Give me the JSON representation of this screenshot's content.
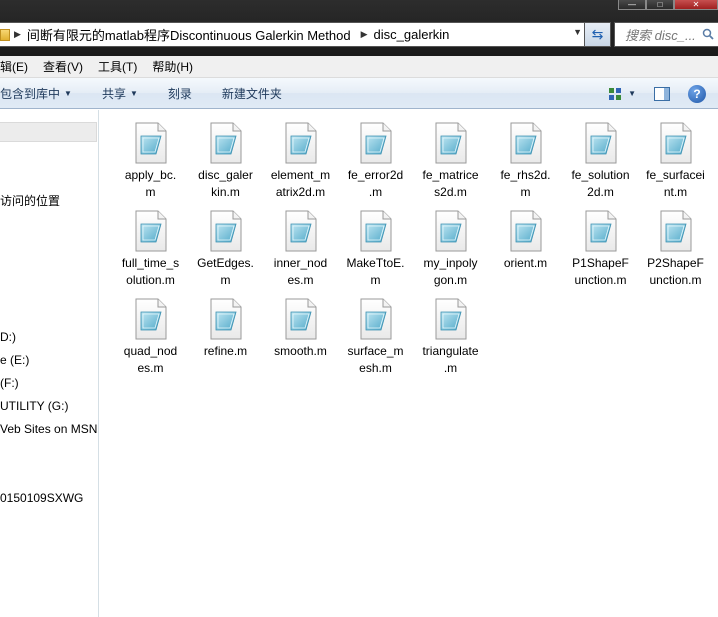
{
  "window": {
    "controls": {
      "minimize": "—",
      "maximize": "□",
      "close": "✕"
    }
  },
  "address": {
    "crumbs": [
      "间断有限元的matlab程序Discontinuous Galerkin Method",
      "disc_galerkin"
    ],
    "search_placeholder": "搜索 disc_..."
  },
  "menu": [
    "编辑(E)",
    "查看(V)",
    "工具(T)",
    "帮助(H)"
  ],
  "menu_visible": [
    "辑(E)",
    "查看(V)",
    "工具(T)",
    "帮助(H)"
  ],
  "toolbar": {
    "include_library": "包含到库中",
    "share": "共享",
    "burn": "刻录",
    "new_folder": "新建文件夹"
  },
  "nav": {
    "items": [
      "访问的位置",
      "D:)",
      "e (E:)",
      " (F:)",
      "UTILITY (G:)",
      "Veb Sites on MSN",
      "0150109SXWG"
    ]
  },
  "files": [
    [
      "apply_bc.",
      "m"
    ],
    [
      "disc_galer",
      "kin.m"
    ],
    [
      "element_m",
      "atrix2d.m"
    ],
    [
      "fe_error2d",
      ".m"
    ],
    [
      "fe_matrice",
      "s2d.m"
    ],
    [
      "fe_rhs2d.",
      "m"
    ],
    [
      "fe_solution",
      "2d.m"
    ],
    [
      "fe_surfacei",
      "nt.m"
    ],
    [
      "full_time_s",
      "olution.m"
    ],
    [
      "GetEdges.",
      "m"
    ],
    [
      "inner_nod",
      "es.m"
    ],
    [
      "MakeTtoE.",
      "m"
    ],
    [
      "my_inpoly",
      "gon.m"
    ],
    [
      "orient.m",
      ""
    ],
    [
      "P1ShapeF",
      "unction.m"
    ],
    [
      "P2ShapeF",
      "unction.m"
    ],
    [
      "quad_nod",
      "es.m"
    ],
    [
      "refine.m",
      ""
    ],
    [
      "smooth.m",
      ""
    ],
    [
      "surface_m",
      "esh.m"
    ],
    [
      "triangulate",
      ".m"
    ]
  ]
}
